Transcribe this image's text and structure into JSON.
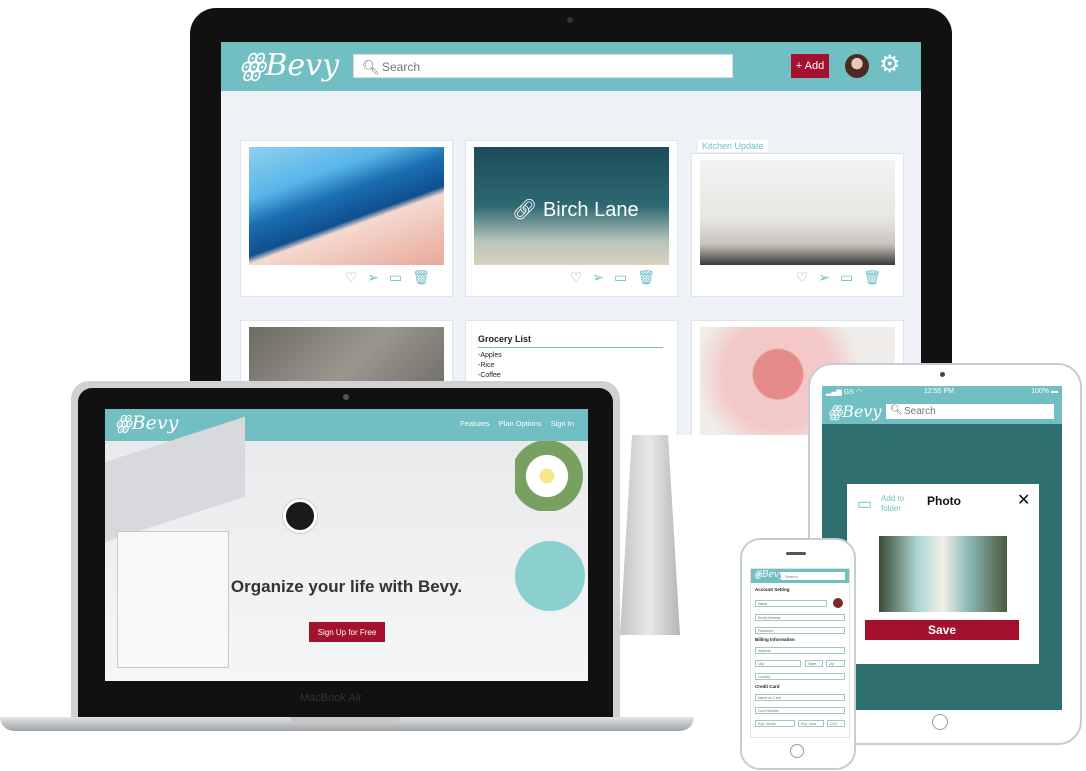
{
  "colors": {
    "accent": "#72bfc3",
    "brand": "#a3112e"
  },
  "imac": {
    "logo": "Bevy",
    "search": {
      "placeholder": "Search"
    },
    "add_label": "+ Add",
    "cards": {
      "birch_lane_title": "Birch Lane",
      "kitchen_label": "Kitchen Update",
      "grocery": {
        "title": "Grocery List",
        "items": [
          "-Apples",
          "-Rice",
          "-Coffee"
        ]
      }
    },
    "icons": {
      "heart": "heart-icon",
      "share": "send-icon",
      "folder": "folder-icon",
      "trash": "trash-icon",
      "settings": "gear-icon"
    }
  },
  "macbook": {
    "logo": "Bevy",
    "nav": [
      "Features",
      "Plan Options",
      "Sign In"
    ],
    "headline": "Organize your life with Bevy.",
    "cta_label": "Sign Up for Free",
    "brand_label": "MacBook Air"
  },
  "ipad": {
    "status": {
      "carrier": "GS",
      "time": "12:55 PM",
      "battery": "100%"
    },
    "logo": "Bevy",
    "search": {
      "placeholder": "Search"
    },
    "modal": {
      "folder_label": "Add to folder",
      "title": "Photo",
      "save_label": "Save"
    }
  },
  "iphone": {
    "logo": "Bevy",
    "search": {
      "placeholder": "Search"
    },
    "account_heading": "Account Setting",
    "billing_heading": "Billing Information",
    "card_heading": "Credit Card",
    "fields": {
      "name": "Name",
      "email": "Email Address",
      "password": "Password",
      "address": "Address",
      "city": "City",
      "state": "State",
      "zip": "Zip",
      "country": "Country",
      "name_on_card": "Name on Card",
      "card_number": "Card Number",
      "exp_month": "Exp. Month",
      "exp_year": "Exp. Year",
      "ccv": "CCV"
    }
  }
}
